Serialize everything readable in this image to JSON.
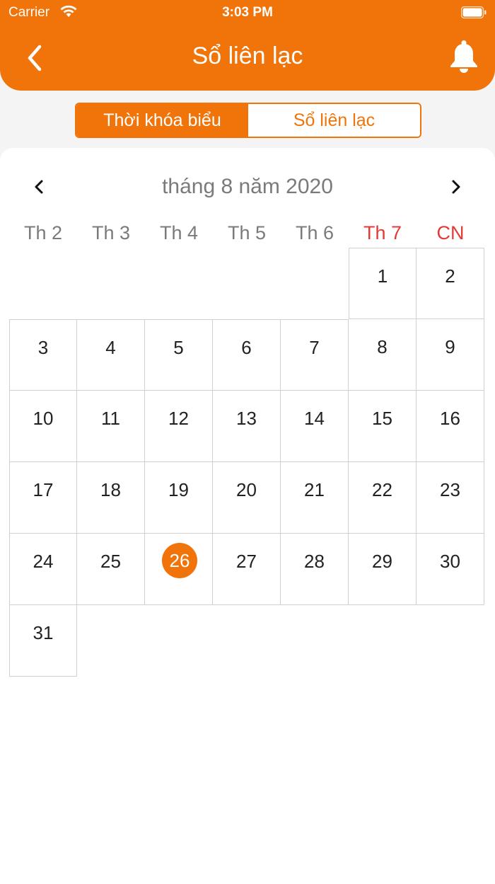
{
  "status_bar": {
    "carrier": "Carrier",
    "time": "3:03 PM"
  },
  "header": {
    "title": "Sổ liên lạc",
    "back_icon": "chevron-left-icon",
    "bell_icon": "bell-icon"
  },
  "tabs": [
    {
      "label": "Thời khóa biểu",
      "active": true
    },
    {
      "label": "Sổ liên lạc",
      "active": false
    }
  ],
  "calendar": {
    "month_title": "tháng 8 năm 2020",
    "weekdays": [
      "Th 2",
      "Th 3",
      "Th 4",
      "Th 5",
      "Th 6",
      "Th 7",
      "CN"
    ],
    "weekend_color": "#e53935",
    "selected_day": "26",
    "weeks": [
      [
        "",
        "",
        "",
        "",
        "",
        "1",
        "2"
      ],
      [
        "3",
        "4",
        "5",
        "6",
        "7",
        "8",
        "9"
      ],
      [
        "10",
        "11",
        "12",
        "13",
        "14",
        "15",
        "16"
      ],
      [
        "17",
        "18",
        "19",
        "20",
        "21",
        "22",
        "23"
      ],
      [
        "24",
        "25",
        "26",
        "27",
        "28",
        "29",
        "30"
      ],
      [
        "31",
        "",
        "",
        "",
        "",
        "",
        ""
      ]
    ]
  },
  "colors": {
    "accent": "#f07409"
  }
}
